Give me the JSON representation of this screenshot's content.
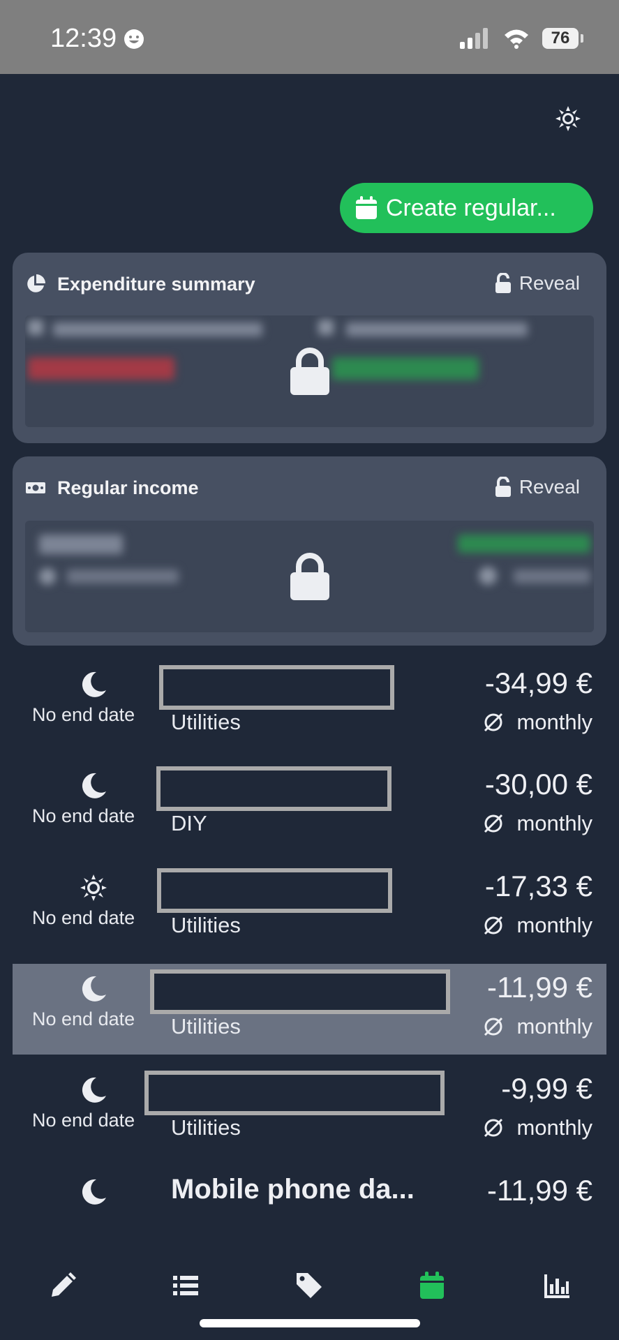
{
  "status": {
    "time": "12:39",
    "battery": "76"
  },
  "header": {
    "create_label": "Create regular..."
  },
  "summary_card": {
    "title": "Expenditure summary",
    "reveal_label": "Reveal"
  },
  "income_card": {
    "title": "Regular income",
    "reveal_label": "Reveal"
  },
  "rows": [
    {
      "end_date": "No end date",
      "category": "Utilities",
      "amount": "-34,99 €",
      "frequency": "monthly"
    },
    {
      "end_date": "No end date",
      "category": "DIY",
      "amount": "-30,00 €",
      "frequency": "monthly"
    },
    {
      "end_date": "No end date",
      "category": "Utilities",
      "amount": "-17,33 €",
      "frequency": "monthly"
    },
    {
      "end_date": "No end date",
      "category": "Utilities",
      "amount": "-11,99 €",
      "frequency": "monthly"
    },
    {
      "end_date": "No end date",
      "category": "Utilities",
      "amount": "-9,99 €",
      "frequency": "monthly"
    },
    {
      "name": "Mobile phone da...",
      "amount": "-11,99 €"
    }
  ],
  "colors": {
    "background": "#1f2838",
    "card": "#475062",
    "accent": "#22c05a",
    "highlight": "#6a7282"
  },
  "icons": [
    "sun-icon",
    "calendar-icon",
    "pie-chart-icon",
    "cash-icon",
    "lock-icon",
    "moon-icon",
    "pencil-icon",
    "list-icon",
    "tag-icon",
    "bar-chart-icon"
  ]
}
